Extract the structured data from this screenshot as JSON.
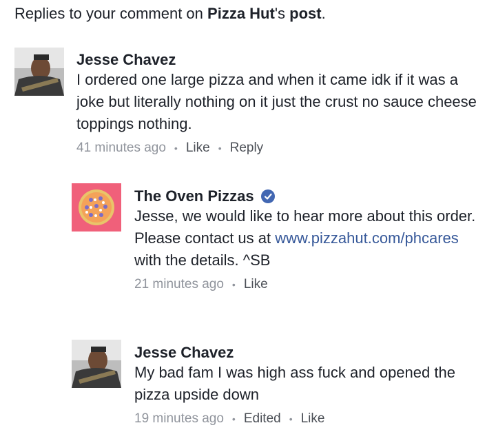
{
  "header": {
    "prefix": "Replies to your comment on ",
    "page_name": "Pizza Hut",
    "middle": "'s ",
    "post_word": "post",
    "end": "."
  },
  "comments": [
    {
      "author": "Jesse Chavez",
      "text": "I ordered one large pizza and when it came idk if it was a joke but literally nothing on it just the crust no sauce cheese toppings nothing.",
      "time": "41 minutes ago",
      "actions": [
        "Like",
        "Reply"
      ]
    },
    {
      "author": "The Oven Pizzas",
      "verified": true,
      "text_before": "Jesse, we would like to hear more about this order. Please contact us at ",
      "link": "www.pizzahut.com/phcares",
      "text_after": " with the details. ^SB",
      "time": "21 minutes ago",
      "actions": [
        "Like"
      ]
    },
    {
      "author": "Jesse Chavez",
      "text": "My bad fam I was high ass fuck and opened the pizza upside down",
      "time": "19 minutes ago",
      "actions": [
        "Edited",
        "Like"
      ]
    }
  ],
  "colors": {
    "text": "#1d2129",
    "meta": "#90949c",
    "link": "#365899",
    "verified_badge": "#4267b2",
    "pizza_avatar_bg": "#f0607a"
  },
  "icons": {
    "verified": "verified-check-icon",
    "separator": "middle-dot"
  }
}
